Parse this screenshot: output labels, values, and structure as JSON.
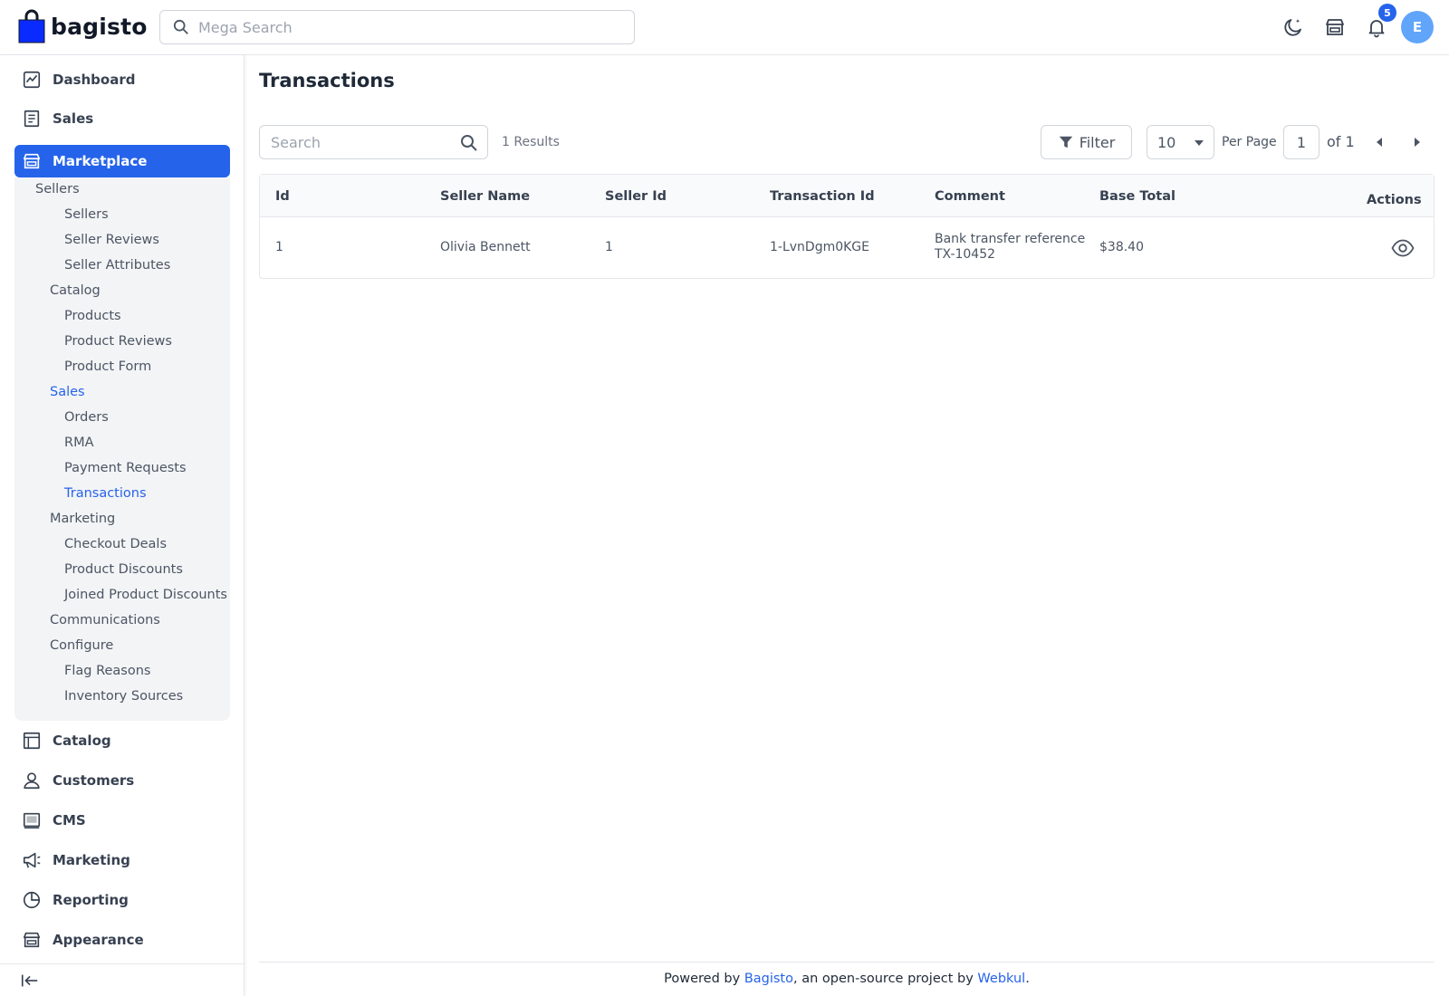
{
  "header": {
    "logo_text": "bagisto",
    "search_placeholder": "Mega Search",
    "notification_count": "5",
    "avatar_initial": "E"
  },
  "sidebar": {
    "main_items": [
      {
        "label": "Dashboard",
        "icon": "dashboard-icon"
      },
      {
        "label": "Sales",
        "icon": "receipt-icon"
      },
      {
        "label": "Marketplace",
        "icon": "store-icon",
        "active": true
      },
      {
        "label": "Catalog",
        "icon": "catalog-icon"
      },
      {
        "label": "Customers",
        "icon": "user-icon"
      },
      {
        "label": "CMS",
        "icon": "cms-icon"
      },
      {
        "label": "Marketing",
        "icon": "megaphone-icon"
      },
      {
        "label": "Reporting",
        "icon": "chart-icon"
      },
      {
        "label": "Appearance",
        "icon": "store-icon"
      }
    ],
    "marketplace_submenu": [
      {
        "label": "Sellers",
        "level": 1
      },
      {
        "label": "Sellers",
        "level": 2
      },
      {
        "label": "Seller Reviews",
        "level": 2
      },
      {
        "label": "Seller Attributes",
        "level": 2
      },
      {
        "label": "Catalog",
        "level": 1
      },
      {
        "label": "Products",
        "level": 2
      },
      {
        "label": "Product Reviews",
        "level": 2
      },
      {
        "label": "Product Form",
        "level": 2
      },
      {
        "label": "Sales",
        "level": 1,
        "active": true
      },
      {
        "label": "Orders",
        "level": 2
      },
      {
        "label": "RMA",
        "level": 2
      },
      {
        "label": "Payment Requests",
        "level": 2
      },
      {
        "label": "Transactions",
        "level": 2,
        "active": true
      },
      {
        "label": "Marketing",
        "level": 1
      },
      {
        "label": "Checkout Deals",
        "level": 2
      },
      {
        "label": "Product Discounts",
        "level": 2
      },
      {
        "label": "Joined Product Discounts",
        "level": 2
      },
      {
        "label": "Communications",
        "level": 1
      },
      {
        "label": "Configure",
        "level": 1
      },
      {
        "label": "Flag Reasons",
        "level": 2
      },
      {
        "label": "Inventory Sources",
        "level": 2
      }
    ]
  },
  "main": {
    "title": "Transactions",
    "search_placeholder": "Search",
    "results": "1 Results",
    "filter_label": "Filter",
    "per_page_value": "10",
    "per_page_label": "Per Page",
    "current_page": "1",
    "total_pages": "of 1",
    "columns": [
      "Id",
      "Seller Name",
      "Seller Id",
      "Transaction Id",
      "Comment",
      "Base Total",
      "Actions"
    ],
    "rows": [
      {
        "id": "1",
        "seller_name": "Olivia Bennett",
        "seller_id": "1",
        "transaction_id": "1-LvnDgm0KGE",
        "comment_line1": "Bank transfer reference",
        "comment_line2": "TX-10452",
        "base_total": "$38.40"
      }
    ]
  },
  "footer": {
    "prefix": "Powered by ",
    "link1": "Bagisto",
    "middle": ", an open-source project by ",
    "link2": "Webkul",
    "suffix": "."
  },
  "colors": {
    "accent": "#2563eb",
    "avatar": "#60a5fa",
    "submenu_bg": "#f3f4f6"
  }
}
